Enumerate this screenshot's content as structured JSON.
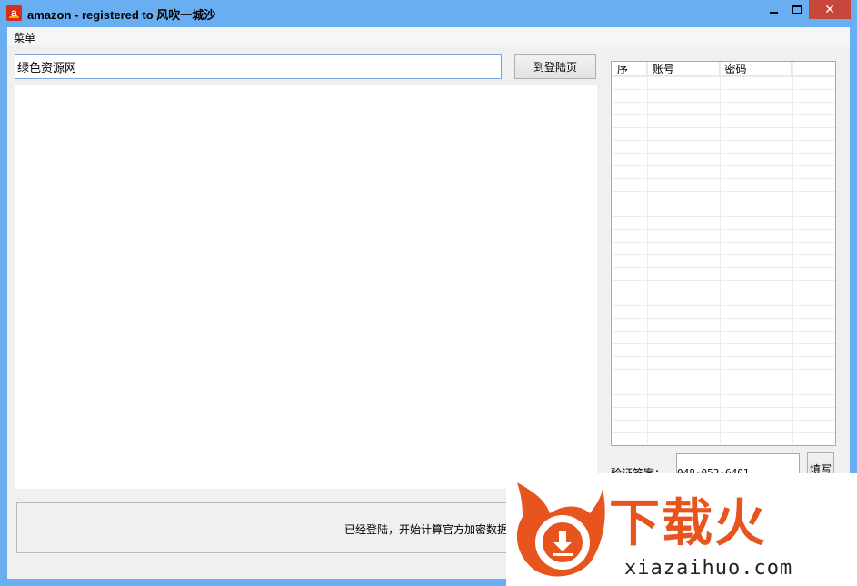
{
  "window": {
    "app_icon_letter": "a",
    "title": "amazon - registered to 风吹一城沙",
    "close_glyph": "✕"
  },
  "menu": {
    "items": [
      "菜单"
    ]
  },
  "toolbar": {
    "url_value": "绿色资源网",
    "go_login_label": "到登陆页"
  },
  "accounts_table": {
    "columns": [
      "序",
      "账号",
      "密码",
      ""
    ],
    "rows": []
  },
  "verify": {
    "label": "验证答案：",
    "value": "048-053-6401",
    "fill_label": "填写"
  },
  "status": {
    "text": "已经登陆，开始计算官方加密数据"
  },
  "watermark": {
    "brand_text": "下载火",
    "domain": "xiazaihuo.com",
    "accent_color": "#e8541d"
  }
}
